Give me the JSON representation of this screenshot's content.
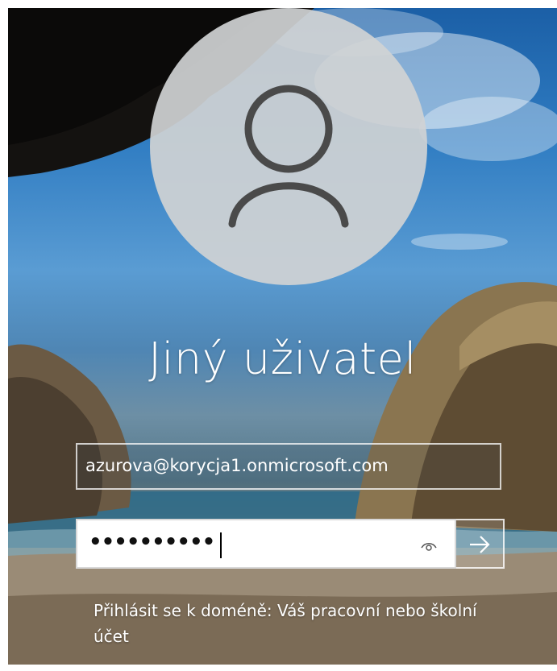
{
  "login": {
    "user_name": "Jiný uživatel",
    "email_value": "azurova@korycja1.onmicrosoft.com",
    "password_masked": "••••••••••",
    "domain_link_text": "Přihlásit se k doméně: Váš pracovní nebo školní účet"
  },
  "icons": {
    "avatar": "user-silhouette-icon",
    "reveal": "eye-icon",
    "submit": "arrow-right-icon"
  },
  "colors": {
    "text": "#ffffff",
    "avatar_circle": "#d0d2d4",
    "avatar_glyph": "#4a4a4a",
    "password_field_bg": "#ffffff"
  }
}
